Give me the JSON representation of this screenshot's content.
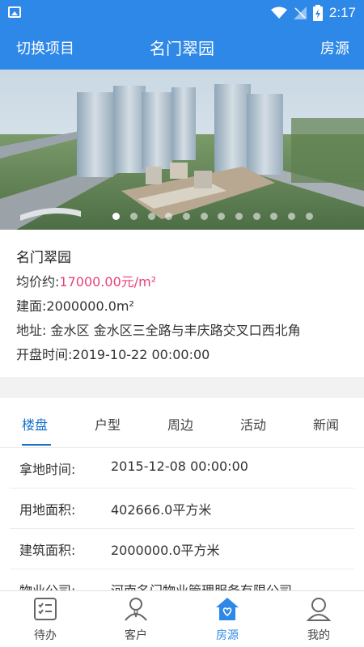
{
  "status_bar": {
    "time": "2:17"
  },
  "header": {
    "left_label": "切换项目",
    "title": "名门翠园",
    "right_label": "房源"
  },
  "banner": {
    "dot_count": 12,
    "active_index": 0
  },
  "project": {
    "name": "名门翠园",
    "avg_price_label": "均价约:",
    "avg_price_value": "17000.00元/m²",
    "area": "建面:2000000.0m²",
    "address": "地址: 金水区   金水区三全路与丰庆路交叉口西北角",
    "opening": "开盘时间:2019-10-22 00:00:00"
  },
  "tabs": [
    "楼盘",
    "户型",
    "周边",
    "活动",
    "新闻"
  ],
  "active_tab": 0,
  "details": [
    {
      "key": "拿地时间:",
      "value": "2015-12-08 00:00:00"
    },
    {
      "key": "用地面积:",
      "value": "402666.0平方米"
    },
    {
      "key": "建筑面积:",
      "value": "2000000.0平方米"
    },
    {
      "key": "物业公司:",
      "value": "河南名门物业管理服务有限公司"
    }
  ],
  "bottom_nav": [
    {
      "label": "待办",
      "icon": "todo-icon"
    },
    {
      "label": "客户",
      "icon": "customer-icon"
    },
    {
      "label": "房源",
      "icon": "house-icon"
    },
    {
      "label": "我的",
      "icon": "profile-icon"
    }
  ],
  "active_nav": 2,
  "colors": {
    "primary": "#2e88e8",
    "price": "#e8407a",
    "tab_active": "#1a73c8"
  }
}
